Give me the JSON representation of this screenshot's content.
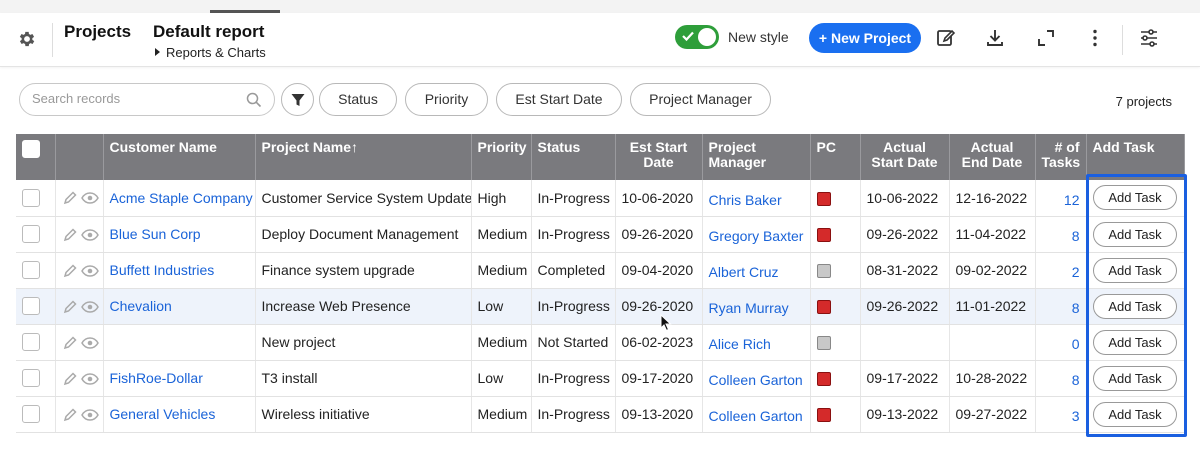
{
  "header": {
    "app_title": "Projects",
    "report_title": "Default report",
    "report_sub": "Reports & Charts",
    "new_style_label": "New style",
    "new_style_on": true,
    "new_project_label": "+ New Project"
  },
  "toolbar": {
    "search_placeholder": "Search records",
    "filters": [
      "Status",
      "Priority",
      "Est Start Date",
      "Project Manager"
    ],
    "count": "7 projects"
  },
  "columns": {
    "customer": "Customer Name",
    "project": "Project Name↑",
    "priority": "Priority",
    "status": "Status",
    "est_start": "Est Start Date",
    "pm": "Project Manager",
    "pc": "PC",
    "act_start": "Actual Start Date",
    "act_end": "Actual End Date",
    "tasks": "# of Tasks",
    "add": "Add Task"
  },
  "rows": [
    {
      "customer": "Acme Staple Company",
      "project": "Customer Service System Update",
      "priority": "High",
      "status": "In-Progress",
      "est_start": "10-06-2020",
      "pm": "Chris Baker",
      "pc": "red",
      "act_start": "10-06-2022",
      "act_end": "12-16-2022",
      "tasks": "12",
      "add": "Add Task"
    },
    {
      "customer": "Blue Sun Corp",
      "project": "Deploy Document Management",
      "priority": "Medium",
      "status": "In-Progress",
      "est_start": "09-26-2020",
      "pm": "Gregory Baxter",
      "pc": "red",
      "act_start": "09-26-2022",
      "act_end": "11-04-2022",
      "tasks": "8",
      "add": "Add Task"
    },
    {
      "customer": "Buffett Industries",
      "project": "Finance system upgrade",
      "priority": "Medium",
      "status": "Completed",
      "est_start": "09-04-2020",
      "pm": "Albert Cruz",
      "pc": "gray",
      "act_start": "08-31-2022",
      "act_end": "09-02-2022",
      "tasks": "2",
      "add": "Add Task"
    },
    {
      "customer": "Chevalion",
      "project": "Increase Web Presence",
      "priority": "Low",
      "status": "In-Progress",
      "est_start": "09-26-2020",
      "pm": "Ryan Murray",
      "pc": "red",
      "act_start": "09-26-2022",
      "act_end": "11-01-2022",
      "tasks": "8",
      "add": "Add Task"
    },
    {
      "customer": "",
      "project": "New project",
      "priority": "Medium",
      "status": "Not Started",
      "est_start": "06-02-2023",
      "pm": "Alice Rich",
      "pc": "gray",
      "act_start": "",
      "act_end": "",
      "tasks": "0",
      "add": "Add Task"
    },
    {
      "customer": "FishRoe-Dollar",
      "project": "T3 install",
      "priority": "Low",
      "status": "In-Progress",
      "est_start": "09-17-2020",
      "pm": "Colleen Garton",
      "pc": "red",
      "act_start": "09-17-2022",
      "act_end": "10-28-2022",
      "tasks": "8",
      "add": "Add Task"
    },
    {
      "customer": "General Vehicles",
      "project": "Wireless initiative",
      "priority": "Medium",
      "status": "In-Progress",
      "est_start": "09-13-2020",
      "pm": "Colleen Garton",
      "pc": "red",
      "act_start": "09-13-2022",
      "act_end": "09-27-2022",
      "tasks": "3",
      "add": "Add Task"
    }
  ],
  "colors": {
    "accent": "#1a6ff0",
    "toggle_on": "#2e9e3a",
    "header_bg": "#7a7a7e",
    "link": "#1a63d8",
    "pc_red": "#d42a2a",
    "pc_gray": "#c8c8c8",
    "highlight_border": "#1a5fe0"
  }
}
